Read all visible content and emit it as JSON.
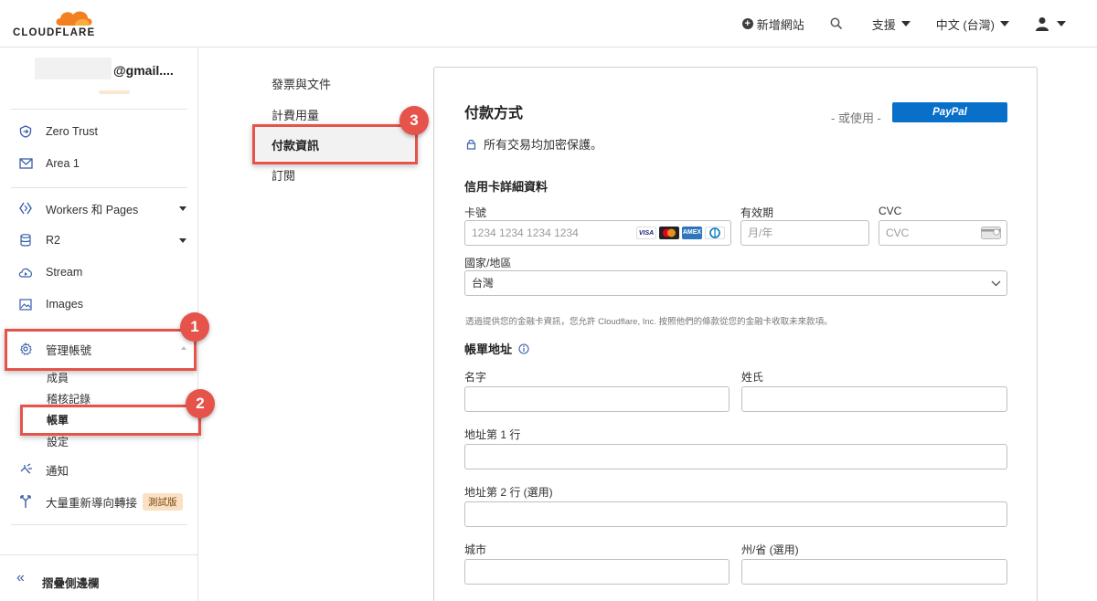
{
  "header": {
    "logo_text": "CLOUDFLARE",
    "add_site": "新增網站",
    "support": "支援",
    "language": "中文 (台灣)"
  },
  "sidebar": {
    "account_email": "@gmail....",
    "items": [
      {
        "label": "Zero Trust",
        "icon": "zero-trust-icon"
      },
      {
        "label": "Area 1",
        "icon": "mail-icon"
      },
      {
        "label": "Workers 和 Pages",
        "icon": "workers-icon"
      },
      {
        "label": "R2",
        "icon": "database-icon"
      },
      {
        "label": "Stream",
        "icon": "cloud-play-icon"
      },
      {
        "label": "Images",
        "icon": "image-icon"
      },
      {
        "label": "管理帳號",
        "icon": "gear-icon"
      },
      {
        "label": "通知",
        "icon": "notification-icon"
      },
      {
        "label": "大量重新導向轉接",
        "icon": "redirect-icon"
      }
    ],
    "manage_sub": [
      "成員",
      "稽核記錄",
      "帳單",
      "設定"
    ],
    "beta_label": "測試版",
    "collapse_label": "摺疊側邊欄"
  },
  "billing_nav": [
    "發票與文件",
    "計費用量",
    "付款資訊",
    "訂閱"
  ],
  "markers": [
    "1",
    "2",
    "3"
  ],
  "payment": {
    "title": "付款方式",
    "or_use": "- 或使用 -",
    "paypal": "PayPal",
    "secure_text": "所有交易均加密保護。",
    "card_section": "信用卡詳細資料",
    "card_number_label": "卡號",
    "card_number_placeholder": "1234 1234 1234 1234",
    "card_brands": [
      "VISA",
      "MC",
      "AMEX",
      "DC"
    ],
    "expiry_label": "有效期",
    "expiry_placeholder": "月/年",
    "cvc_label": "CVC",
    "cvc_placeholder": "CVC",
    "country_label": "國家/地區",
    "country_value": "台灣",
    "notice": "透過提供您的金融卡資訊，您允許 Cloudflare, Inc. 按照他們的條款從您的金融卡收取未來款項。",
    "billing_section": "帳單地址",
    "first_name": "名字",
    "last_name": "姓氏",
    "address1": "地址第 1 行",
    "address2": "地址第 2 行 (選用)",
    "city": "城市",
    "state": "州/省 (選用)"
  },
  "colors": {
    "highlight": "#e5534b",
    "paypal_blue": "#0870c9",
    "cloudflare_orange": "#f38020"
  }
}
